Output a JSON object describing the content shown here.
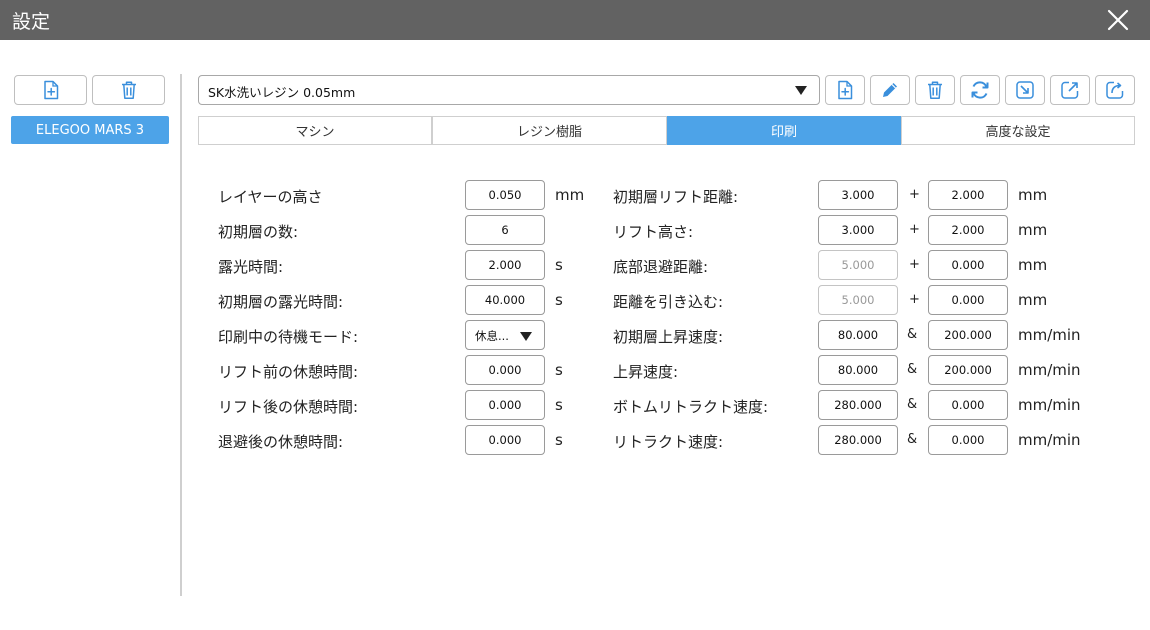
{
  "window": {
    "title": "設定"
  },
  "sidebar": {
    "machines": [
      "ELEGOO MARS 3"
    ]
  },
  "profile": {
    "selected": "SK水洗いレジン 0.05mm"
  },
  "tabs": [
    "マシン",
    "レジン樹脂",
    "印刷",
    "高度な設定"
  ],
  "active_tab": "印刷",
  "icons": {
    "add_file": "file-plus-icon",
    "delete": "trash-icon",
    "edit": "pencil-icon",
    "refresh": "refresh-icon",
    "import": "import-icon",
    "export": "export-icon",
    "share": "share-icon",
    "close": "close-icon"
  },
  "colors": {
    "titlebar": "#626262",
    "accent": "#4da3e8"
  },
  "left_settings": [
    {
      "label": "レイヤーの高さ",
      "value": "0.050",
      "unit": "mm"
    },
    {
      "label": "初期層の数:",
      "value": "6",
      "unit": ""
    },
    {
      "label": "露光時間:",
      "value": "2.000",
      "unit": "s"
    },
    {
      "label": "初期層の露光時間:",
      "value": "40.000",
      "unit": "s"
    },
    {
      "label": "印刷中の待機モード:",
      "value": "休息...",
      "unit": ""
    },
    {
      "label": "リフト前の休憩時間:",
      "value": "0.000",
      "unit": "s"
    },
    {
      "label": "リフト後の休憩時間:",
      "value": "0.000",
      "unit": "s"
    },
    {
      "label": "退避後の休憩時間:",
      "value": "0.000",
      "unit": "s"
    }
  ],
  "right_settings": [
    {
      "label": "初期層リフト距離:",
      "v1": "3.000",
      "op": "+",
      "v2": "2.000",
      "unit": "mm"
    },
    {
      "label": "リフト高さ:",
      "v1": "3.000",
      "op": "+",
      "v2": "2.000",
      "unit": "mm"
    },
    {
      "label": "底部退避距離:",
      "v1": "5.000",
      "op": "+",
      "v2": "0.000",
      "unit": "mm"
    },
    {
      "label": "距離を引き込む:",
      "v1": "5.000",
      "op": "+",
      "v2": "0.000",
      "unit": "mm"
    },
    {
      "label": "初期層上昇速度:",
      "v1": "80.000",
      "op": "&",
      "v2": "200.000",
      "unit": "mm/min"
    },
    {
      "label": "上昇速度:",
      "v1": "80.000",
      "op": "&",
      "v2": "200.000",
      "unit": "mm/min"
    },
    {
      "label": "ボトムリトラクト速度:",
      "v1": "280.000",
      "op": "&",
      "v2": "0.000",
      "unit": "mm/min"
    },
    {
      "label": "リトラクト速度:",
      "v1": "280.000",
      "op": "&",
      "v2": "0.000",
      "unit": "mm/min"
    }
  ]
}
